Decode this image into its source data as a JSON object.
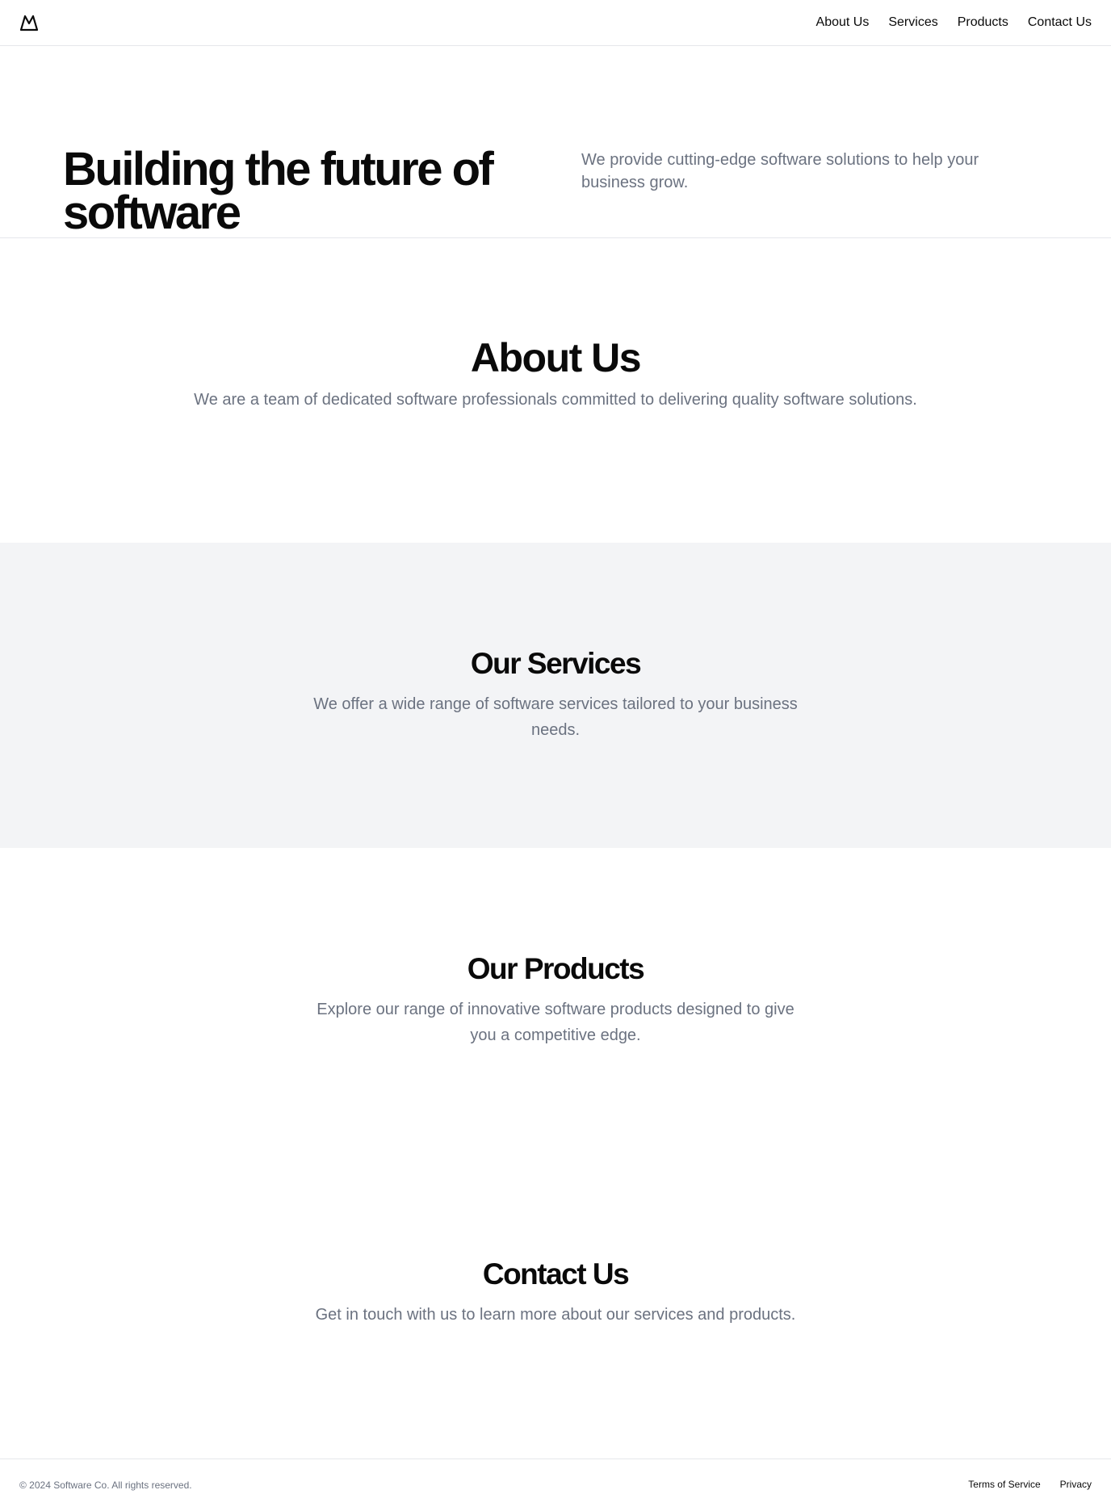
{
  "header": {
    "logo_icon": "mountain-icon",
    "nav": [
      {
        "label": "About Us"
      },
      {
        "label": "Services"
      },
      {
        "label": "Products"
      },
      {
        "label": "Contact Us"
      }
    ]
  },
  "hero": {
    "title": "Building the future of software",
    "text": "We provide cutting-edge software solutions to help your business grow."
  },
  "about": {
    "title": "About Us",
    "text": "We are a team of dedicated software professionals committed to delivering quality software solutions."
  },
  "services": {
    "title": "Our Services",
    "text": "We offer a wide range of software services tailored to your business needs."
  },
  "products": {
    "title": "Our Products",
    "text": "Explore our range of innovative software products designed to give you a competitive edge."
  },
  "contact": {
    "title": "Contact Us",
    "text": "Get in touch with us to learn more about our services and products."
  },
  "footer": {
    "copyright": "© 2024 Software Co. All rights reserved.",
    "links": [
      {
        "label": "Terms of Service"
      },
      {
        "label": "Privacy"
      }
    ]
  },
  "colors": {
    "text_primary": "#0a0a0a",
    "text_muted": "#6b7280",
    "section_bg": "#f3f4f6",
    "border": "#e5e7eb"
  }
}
